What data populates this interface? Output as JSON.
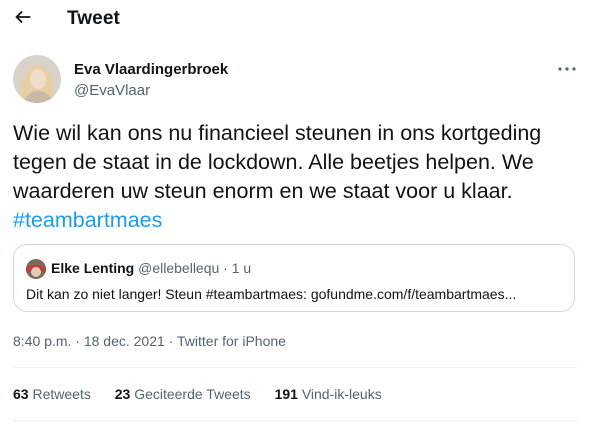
{
  "header": {
    "title": "Tweet",
    "back_icon": "arrow-left-icon"
  },
  "author": {
    "display_name": "Eva Vlaardingerbroek",
    "handle": "@EvaVlaar",
    "more_icon": "more-dots-icon"
  },
  "tweet": {
    "text": "Wie wil kan ons nu financieel steunen in ons kortgeding tegen de staat in de lockdown. Alle beetjes helpen. We waarderen uw steun enorm en we staat voor u klaar.",
    "hashtag": "#teambartmaes"
  },
  "quote": {
    "display_name": "Elke Lenting",
    "handle": "@ellebellequ",
    "separator": "·",
    "time": "1 u",
    "text": "Dit kan zo niet langer! Steun #teambartmaes: gofundme.com/f/teambartmaes..."
  },
  "meta": {
    "time": "8:40 p.m.",
    "separator": "·",
    "date": "18 dec. 2021",
    "source": "Twitter for iPhone"
  },
  "stats": {
    "retweets_count": "63",
    "retweets_label": "Retweets",
    "quotes_count": "23",
    "quotes_label": "Geciteerde Tweets",
    "likes_count": "191",
    "likes_label": "Vind-ik-leuks"
  },
  "colors": {
    "accent": "#1d9bf0",
    "text": "#0f1419",
    "secondary_text": "#536471",
    "border": "#cfd9de"
  }
}
